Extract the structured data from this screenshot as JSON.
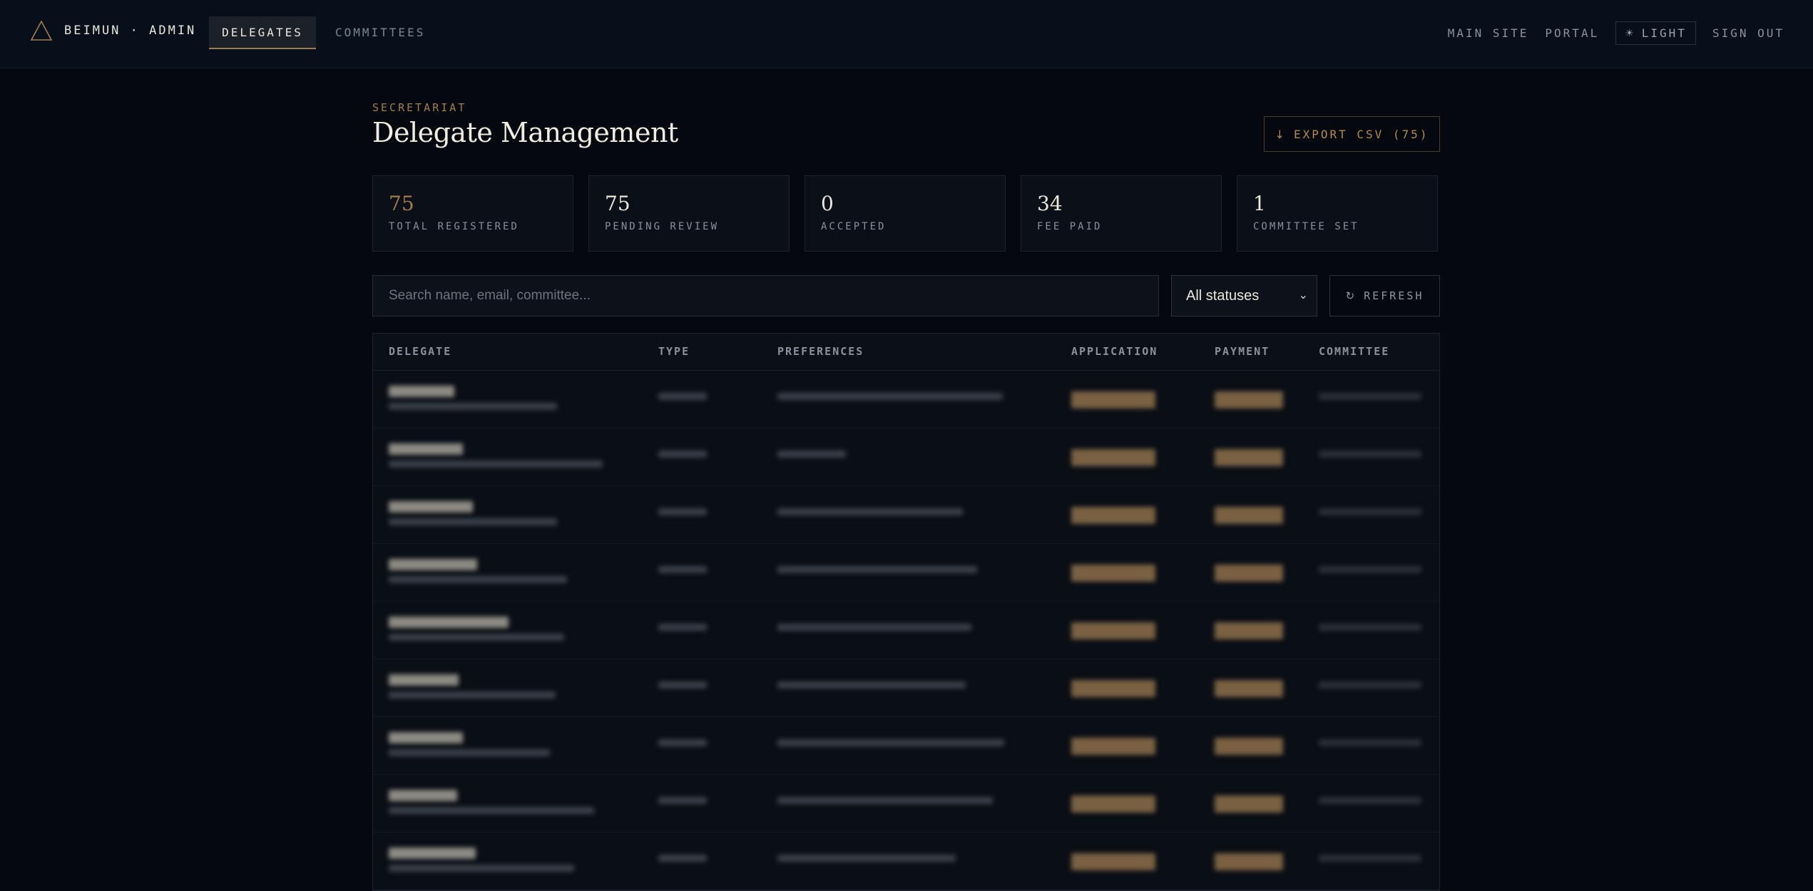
{
  "nav": {
    "brand": "BEIMUN · ADMIN",
    "tabs": [
      {
        "label": "DELEGATES",
        "active": true
      },
      {
        "label": "COMMITTEES",
        "active": false
      }
    ],
    "right": {
      "main_site": "MAIN SITE",
      "portal": "PORTAL",
      "theme_toggle": "LIGHT",
      "sign_out": "SIGN OUT"
    }
  },
  "header": {
    "eyebrow": "SECRETARIAT",
    "title": "Delegate Management",
    "export_label": "EXPORT CSV (75)"
  },
  "stats": [
    {
      "value": "75",
      "label": "TOTAL REGISTERED"
    },
    {
      "value": "75",
      "label": "PENDING REVIEW"
    },
    {
      "value": "0",
      "label": "ACCEPTED"
    },
    {
      "value": "34",
      "label": "FEE PAID"
    },
    {
      "value": "1",
      "label": "COMMITTEE SET"
    }
  ],
  "filters": {
    "search_placeholder": "Search name, email, committee...",
    "status_selected": "All statuses",
    "refresh_label": "REFRESH"
  },
  "table": {
    "columns": [
      "DELEGATE",
      "TYPE",
      "PREFERENCES",
      "APPLICATION",
      "PAYMENT",
      "COMMITTEE"
    ]
  },
  "colors": {
    "accent": "#a37d4e",
    "background": "#05080e",
    "badge": "#7a6143"
  }
}
